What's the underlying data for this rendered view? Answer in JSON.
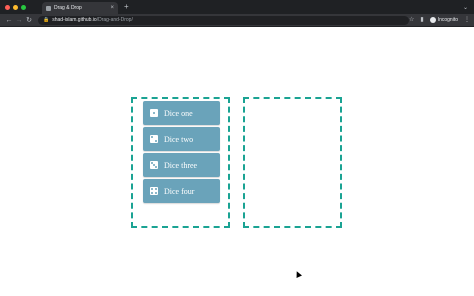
{
  "browser": {
    "tab_title": "Drag & Drop",
    "tab_close": "×",
    "new_tab": "+",
    "url_host": "shad-islam.github.io",
    "url_path": "/Drag-and-Drop/",
    "incognito_label": "Incognito",
    "traffic_colors": [
      "#ff5f57",
      "#febc2e",
      "#28c840"
    ]
  },
  "dice": [
    {
      "label": "Dice one",
      "icon": "dice-one-icon"
    },
    {
      "label": "Dice two",
      "icon": "dice-two-icon"
    },
    {
      "label": "Dice three",
      "icon": "dice-three-icon"
    },
    {
      "label": "Dice four",
      "icon": "dice-four-icon"
    }
  ],
  "colors": {
    "dropzone_border": "#1aa393",
    "dice_bg": "#6aa3ba"
  }
}
